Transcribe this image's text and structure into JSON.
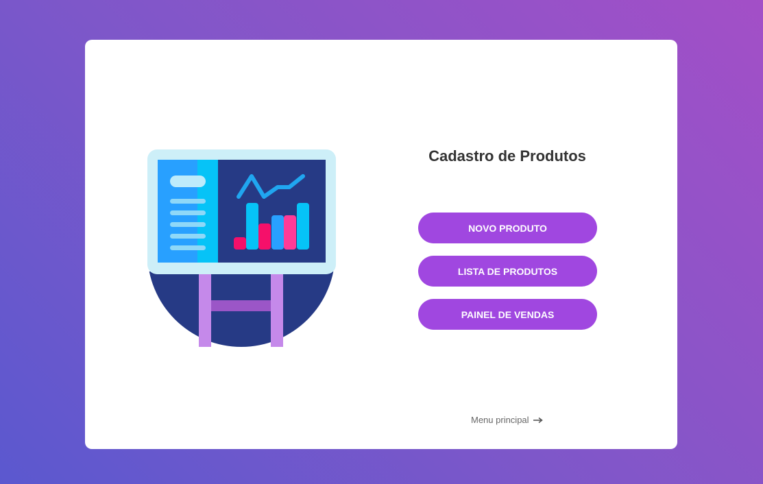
{
  "title": "Cadastro de Produtos",
  "buttons": {
    "new_product": "NOVO PRODUTO",
    "product_list": "LISTA DE PRODUTOS",
    "sales_panel": "PAINEL DE VENDAS"
  },
  "footer": {
    "back_link_label": "Menu principal",
    "back_link_icon": "arrow-right-icon"
  },
  "illustration": {
    "icon": "presentation-board-chart-icon"
  },
  "colors": {
    "background_gradient": [
      "#5b58cf",
      "#a34fc7"
    ],
    "card": "#ffffff",
    "button": "#a047e0",
    "title": "#333333"
  }
}
